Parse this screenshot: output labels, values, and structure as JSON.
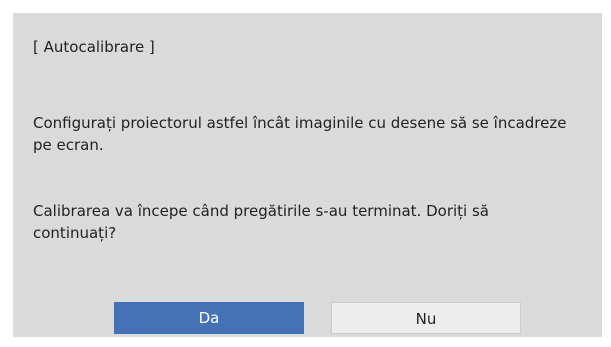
{
  "dialog": {
    "title": "[ Autocalibrare ]",
    "messages": [
      "Configurați proiectorul astfel încât imaginile cu desene să se încadreze pe ecran.",
      "Calibrarea va începe când pregătirile s-au terminat. Doriți să continuați?"
    ],
    "buttons": {
      "yes_label": "Da",
      "no_label": "Nu"
    }
  },
  "colors": {
    "dialog_background": "#dadada",
    "selected_button": "#4572b6",
    "unselected_button": "#ededed"
  }
}
